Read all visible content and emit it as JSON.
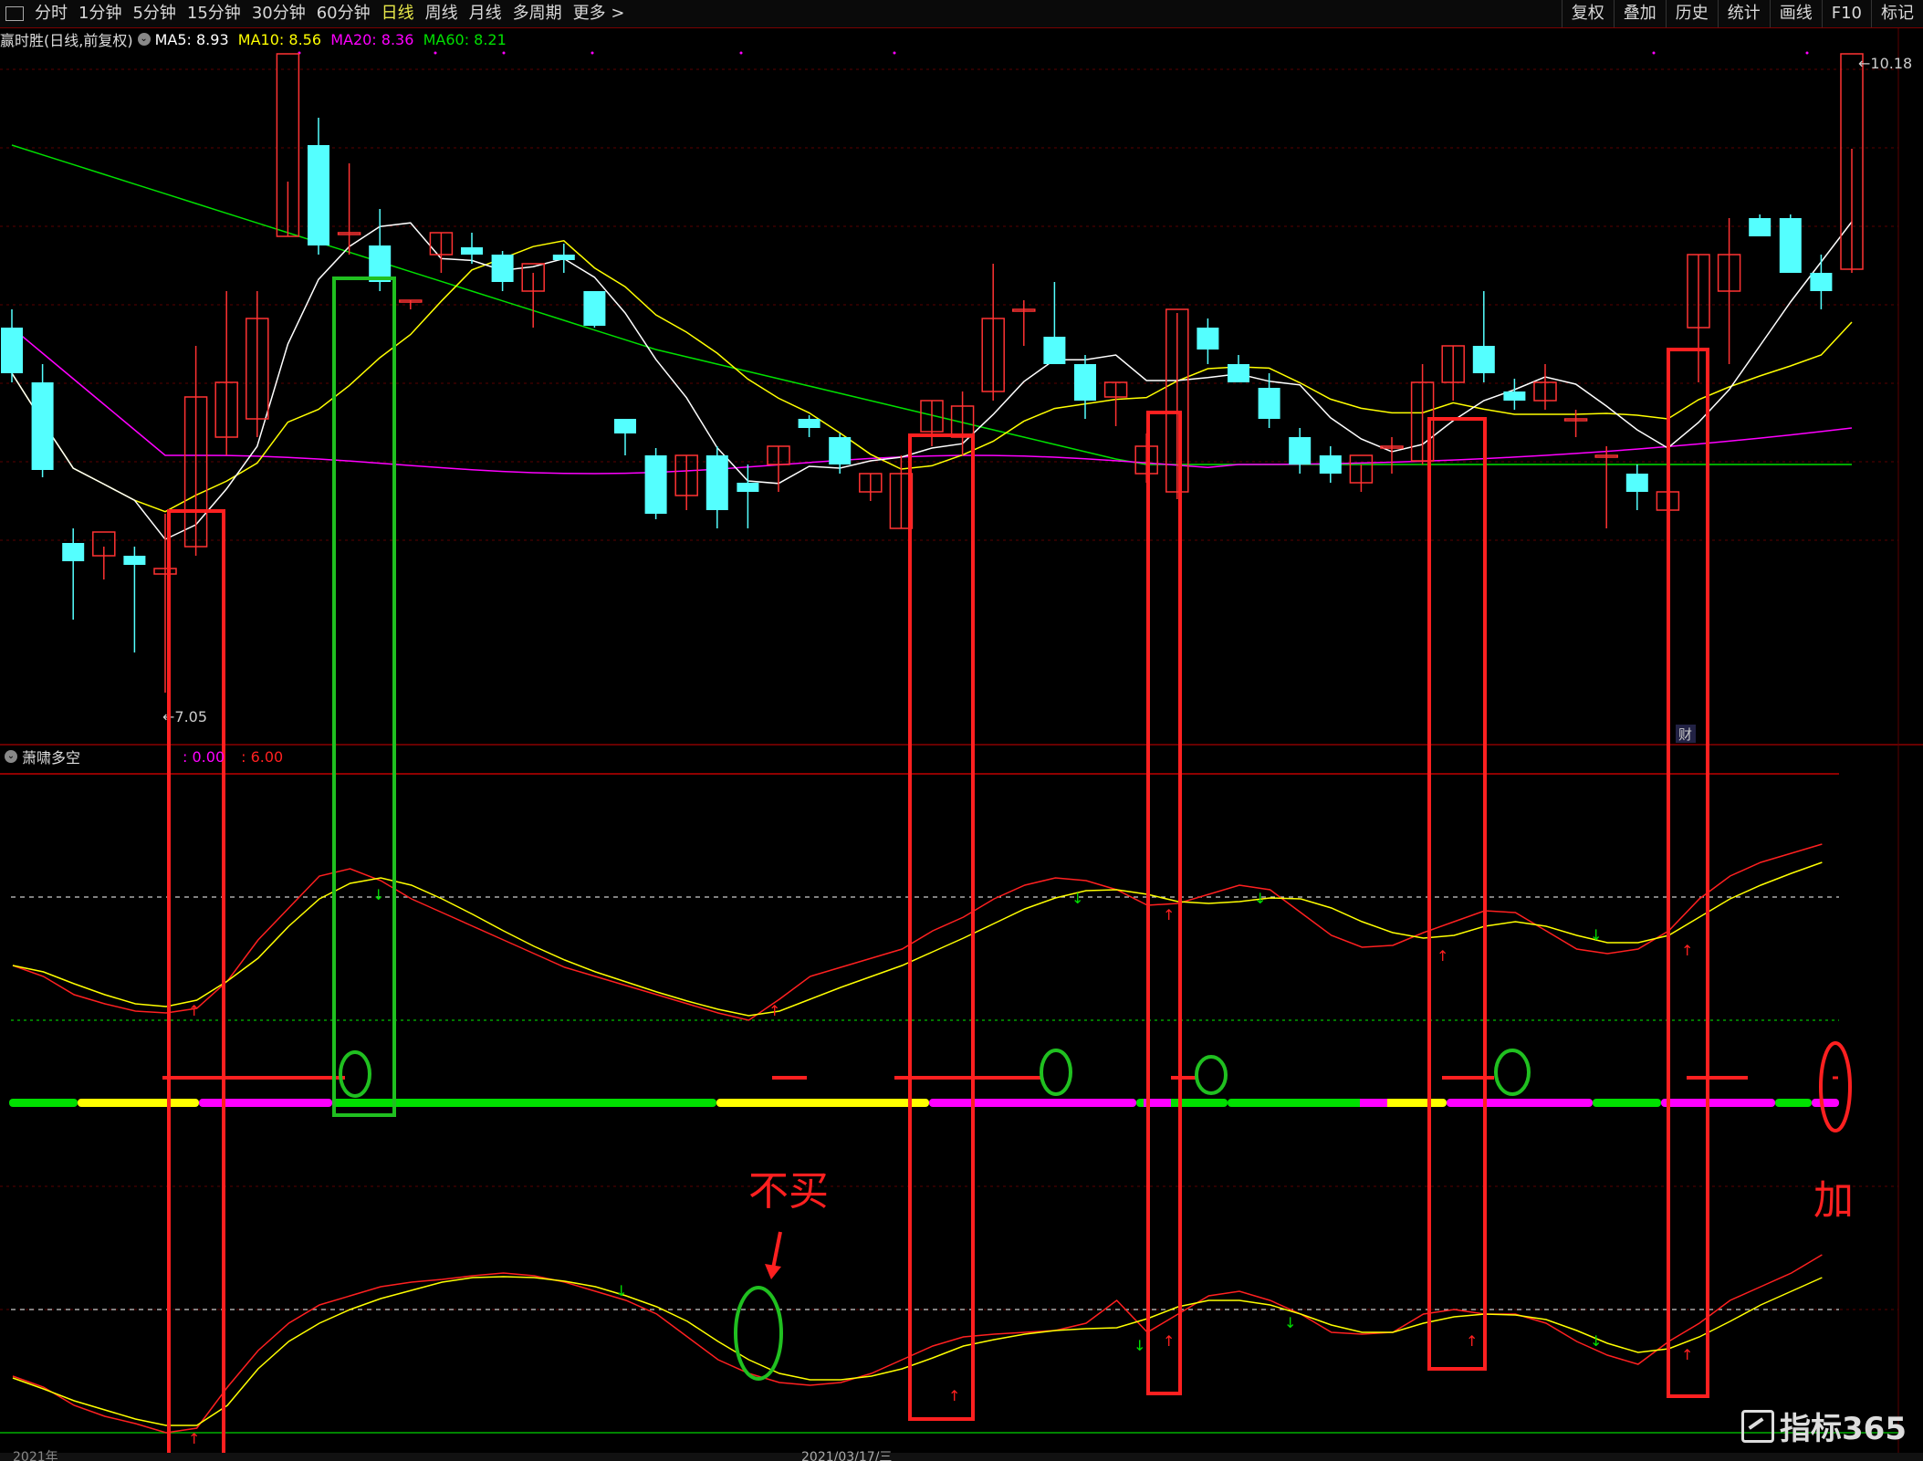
{
  "toolbar": {
    "periods": [
      "分时",
      "1分钟",
      "5分钟",
      "15分钟",
      "30分钟",
      "60分钟",
      "日线",
      "周线",
      "月线",
      "多周期",
      "更多 >"
    ],
    "active_period": "日线",
    "right_buttons": [
      "复权",
      "叠加",
      "历史",
      "统计",
      "画线",
      "F10",
      "标记"
    ]
  },
  "main_info": {
    "stock": "赢时胜",
    "mode": "(日线,前复权)",
    "ma5": "MA5: 8.93",
    "ma10": "MA10: 8.56",
    "ma20": "MA20: 8.36",
    "ma60": "MA60: 8.21"
  },
  "indicator_info": {
    "name": "萧啸多空",
    "v1": ": 0.00",
    "v2": ": 6.00"
  },
  "price_labels": {
    "high": "10.18",
    "low": "7.05"
  },
  "annotations": {
    "no_buy": "不买",
    "add": "加",
    "cai": "财"
  },
  "bottom_axis": {
    "d1": "2021年",
    "d2": "2021/03/17/三"
  },
  "watermark": "指标365",
  "colors": {
    "up": "#ff3232",
    "down": "#54ffff",
    "ma5": "#ffffff",
    "ma10": "#ffff00",
    "ma20": "#ff00ff",
    "ma60": "#00e000",
    "box_red": "#ff2020",
    "box_green": "#20c020"
  },
  "candles": [
    [
      9.2,
      9.3,
      8.9,
      8.95
    ],
    [
      8.9,
      9.0,
      8.38,
      8.42
    ],
    [
      8.02,
      8.1,
      7.6,
      7.92
    ],
    [
      7.95,
      8.0,
      7.82,
      8.08
    ],
    [
      7.95,
      8.0,
      7.42,
      7.9
    ],
    [
      7.85,
      8.18,
      7.2,
      7.88
    ],
    [
      8.0,
      9.1,
      7.95,
      8.82
    ],
    [
      8.6,
      9.4,
      8.5,
      8.9
    ],
    [
      8.7,
      9.4,
      8.6,
      9.25
    ],
    [
      9.7,
      10.0,
      9.7,
      10.7
    ],
    [
      10.2,
      10.35,
      9.6,
      9.65
    ],
    [
      9.72,
      10.1,
      9.6,
      9.72
    ],
    [
      9.65,
      9.85,
      9.4,
      9.45
    ],
    [
      9.35,
      9.35,
      9.3,
      9.35
    ],
    [
      9.6,
      9.72,
      9.5,
      9.72
    ],
    [
      9.64,
      9.72,
      9.55,
      9.6
    ],
    [
      9.6,
      9.62,
      9.4,
      9.45
    ],
    [
      9.4,
      9.5,
      9.2,
      9.55
    ],
    [
      9.6,
      9.66,
      9.5,
      9.57
    ],
    [
      9.4,
      9.4,
      9.2,
      9.21
    ],
    [
      8.7,
      8.7,
      8.5,
      8.62
    ],
    [
      8.5,
      8.54,
      8.15,
      8.18
    ],
    [
      8.28,
      8.5,
      8.2,
      8.5
    ],
    [
      8.5,
      8.55,
      8.1,
      8.2
    ],
    [
      8.35,
      8.45,
      8.1,
      8.3
    ],
    [
      8.45,
      8.55,
      8.3,
      8.55
    ],
    [
      8.7,
      8.72,
      8.6,
      8.65
    ],
    [
      8.6,
      8.62,
      8.4,
      8.45
    ],
    [
      8.3,
      8.4,
      8.25,
      8.4
    ],
    [
      8.1,
      8.5,
      8.1,
      8.4
    ],
    [
      8.63,
      8.8,
      8.55,
      8.8
    ],
    [
      8.6,
      8.85,
      8.5,
      8.77
    ],
    [
      8.85,
      9.55,
      8.8,
      9.25
    ],
    [
      9.3,
      9.35,
      9.1,
      9.3
    ],
    [
      9.15,
      9.45,
      9.0,
      9.0
    ],
    [
      9.0,
      9.05,
      8.7,
      8.8
    ],
    [
      8.82,
      8.9,
      8.66,
      8.9
    ],
    [
      8.4,
      8.62,
      8.35,
      8.55
    ],
    [
      8.3,
      9.28,
      8.26,
      9.3
    ],
    [
      9.2,
      9.25,
      9.0,
      9.08
    ],
    [
      9.0,
      9.05,
      8.9,
      8.9
    ],
    [
      8.87,
      8.95,
      8.65,
      8.7
    ],
    [
      8.6,
      8.65,
      8.4,
      8.45
    ],
    [
      8.5,
      8.55,
      8.35,
      8.4
    ],
    [
      8.35,
      8.45,
      8.3,
      8.5
    ],
    [
      8.55,
      8.6,
      8.4,
      8.55
    ],
    [
      8.47,
      9.0,
      8.45,
      8.9
    ],
    [
      8.9,
      9.1,
      8.8,
      9.1
    ],
    [
      9.1,
      9.4,
      8.9,
      8.95
    ],
    [
      8.85,
      8.92,
      8.75,
      8.8
    ],
    [
      8.8,
      9.0,
      8.75,
      8.9
    ],
    [
      8.7,
      8.75,
      8.6,
      8.7
    ],
    [
      8.5,
      8.55,
      8.1,
      8.5
    ],
    [
      8.4,
      8.45,
      8.2,
      8.3
    ],
    [
      8.2,
      8.4,
      8.1,
      8.3
    ],
    [
      9.2,
      9.6,
      8.9,
      9.6
    ],
    [
      9.4,
      9.8,
      9.0,
      9.6
    ],
    [
      9.8,
      9.82,
      9.7,
      9.7
    ],
    [
      9.8,
      9.82,
      9.5,
      9.5
    ],
    [
      9.5,
      9.6,
      9.3,
      9.4
    ],
    [
      9.52,
      10.18,
      9.5,
      10.7
    ]
  ]
}
